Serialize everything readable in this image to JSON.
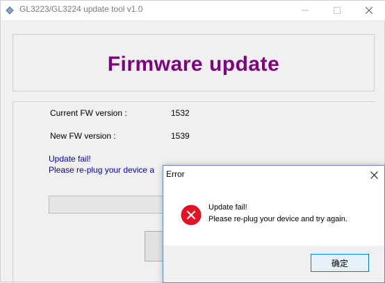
{
  "window": {
    "title": "GL3223/GL3224 update tool v1.0",
    "controls": {
      "minimize": "—",
      "maximize": "☐",
      "close": "✕"
    }
  },
  "header": {
    "headline": "Firmware update",
    "headline_color": "#800080"
  },
  "info": {
    "current_label": "Current FW version :",
    "current_value": "1532",
    "new_label": "New FW version :",
    "new_value": "1539",
    "status_line1": "Update fail!",
    "status_line2": "Please re-plug your device a"
  },
  "progress": {
    "value": 0
  },
  "dialog": {
    "title": "Error",
    "icon": "error-icon",
    "message_line1": "Update fail!",
    "message_line2": "Please re-plug your device and try again.",
    "ok_label": "确定"
  }
}
